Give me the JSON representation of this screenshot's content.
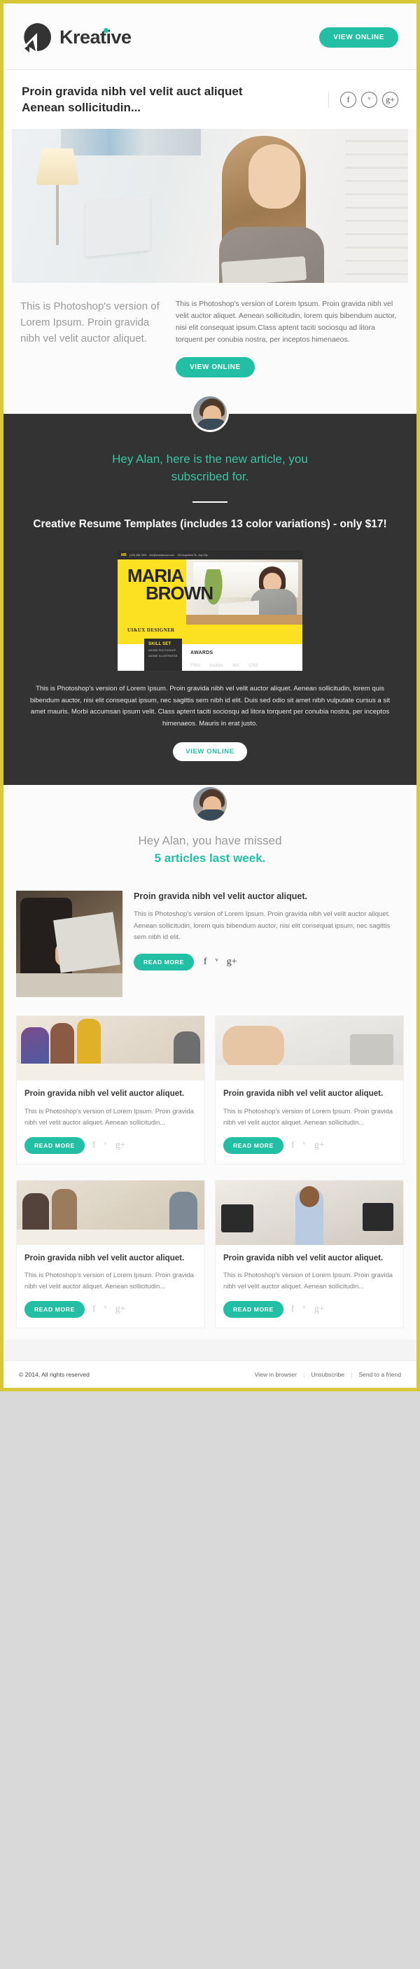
{
  "colors": {
    "accent_teal": "#23bfa5",
    "border_yellow": "#d8c838",
    "dark_bg": "#333333",
    "resume_yellow": "#fbe122"
  },
  "header": {
    "brand_name": "Kreative",
    "view_online_label": "VIEW ONLINE"
  },
  "headline": {
    "text": "Proin gravida nibh vel velit auct aliquet Aenean sollicitudin...",
    "social": [
      {
        "name": "facebook-icon",
        "glyph": "f"
      },
      {
        "name": "twitter-icon",
        "glyph": "ᵛ"
      },
      {
        "name": "googleplus-icon",
        "glyph": "g+"
      }
    ]
  },
  "intro": {
    "left_text": "This is Photoshop's version of Lorem Ipsum. Proin gravida nibh vel velit auctor aliquet.",
    "right_text": "This is Photoshop's version of Lorem Ipsum. Proin gravida nibh vel velit auctor aliquet. Aenean sollicitudin, lorem quis bibendum auctor, nisi elit consequat ipsum.Class aptent taciti sociosqu ad litora torquent per conubia nostra, per inceptos himenaeos.",
    "button_label": "VIEW ONLINE"
  },
  "dark_section": {
    "greeting": "Hey Alan, here is the new article, you subscribed for.",
    "product_title": "Creative Resume Templates (includes 13 color variations) - only $17!",
    "body": "This is Photoshop's version of Lorem Ipsum. Proin gravida nibh vel velit auctor aliquet. Aenean sollicitudin, lorem quis bibendum auctor, nisi elit consequat ipsum, nec sagittis sem nibh id elit. Duis sed odio sit amet nibh vulputate cursus a sit amet mauris. Morbi accumsan ipsum velit. Class aptent taciti sociosqu ad litora torquent per conubia nostra, per inceptos himenaeos. Mauris in erat justo.",
    "button_label": "VIEW ONLINE",
    "resume": {
      "logo": "MB",
      "contact_phone": "(123) 456-7890",
      "contact_email": "info@mariabrown.com",
      "contact_addr": "123 Anywhere St., Any City",
      "first_name": "MARIA",
      "last_name": "BROWN",
      "role": "UI&UX DESIGNER",
      "skill_title": "SKILL SET",
      "skills": [
        "ADOBE PHOTOSHOP",
        "ADOBE ILLUSTRATOR"
      ],
      "awards_title": "AWARDS",
      "award_logos": [
        "FWA",
        "freddie",
        "WA",
        "CSS"
      ]
    }
  },
  "missed_section": {
    "line1": "Hey Alan, you have missed",
    "line2": "5 articles last week."
  },
  "featured_article": {
    "title": "Proin gravida nibh vel velit auctor aliquet.",
    "excerpt": "This is Photoshop's version of Lorem Ipsum. Proin gravida nibh vel velit auctor aliquet. Aenean sollicitudin, lorem quis bibendum auctor, nisi elit consequat ipsum, nec sagittis sem nibh id elit.",
    "button_label": "READ MORE",
    "social": [
      {
        "name": "facebook-icon",
        "glyph": "f"
      },
      {
        "name": "twitter-icon",
        "glyph": "ᵛ"
      },
      {
        "name": "googleplus-icon",
        "glyph": "g+"
      }
    ]
  },
  "cards": [
    {
      "title": "Proin gravida nibh vel velit auctor aliquet.",
      "excerpt": "This is Photoshop's version of Lorem Ipsum. Proin gravida nibh vel velit auctor aliquet. Aenean sollicitudin...",
      "button_label": "READ MORE"
    },
    {
      "title": "Proin gravida nibh vel velit auctor aliquet.",
      "excerpt": "This is Photoshop's version of Lorem Ipsum. Proin gravida nibh vel velit auctor aliquet. Aenean sollicitudin...",
      "button_label": "READ MORE"
    },
    {
      "title": "Proin gravida nibh vel velit auctor aliquet.",
      "excerpt": "This is Photoshop's version of Lorem Ipsum. Proin gravida nibh vel velit auctor aliquet. Aenean sollicitudin...",
      "button_label": "READ MORE"
    },
    {
      "title": "Proin gravida nibh vel velit auctor aliquet.",
      "excerpt": "This is Photoshop's version of Lorem Ipsum. Proin gravida nibh vel velit auctor aliquet. Aenean sollicitudin...",
      "button_label": "READ MORE"
    }
  ],
  "footer": {
    "copyright": "© 2014, All rights reserved",
    "links": [
      "View in browser",
      "Unsubscribe",
      "Send to a friend"
    ]
  }
}
